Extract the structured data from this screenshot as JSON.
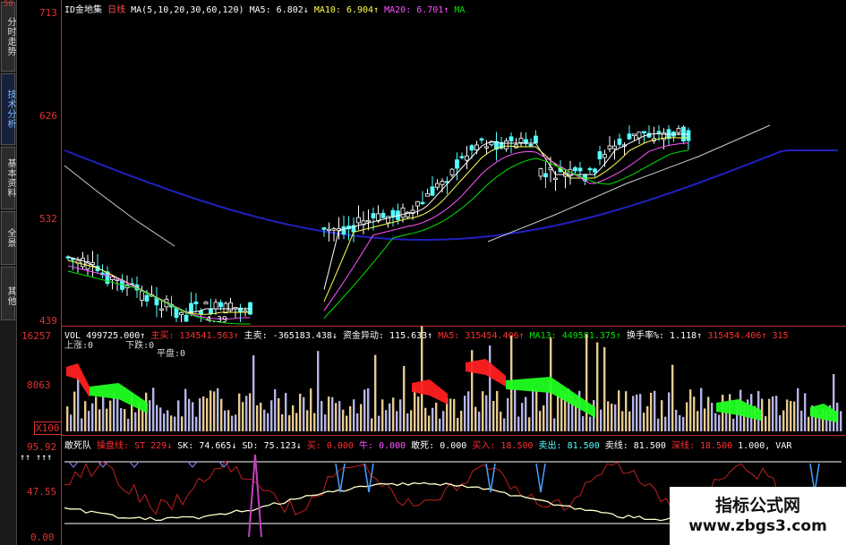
{
  "sidebar": {
    "tabs": [
      {
        "label": "分时走势",
        "active": false
      },
      {
        "label": "技术分析",
        "active": true
      },
      {
        "label": "基本资料",
        "active": false
      },
      {
        "label": "全景",
        "active": false
      },
      {
        "label": "其他",
        "active": false
      }
    ]
  },
  "main_panel": {
    "stock_name": "ID金地集",
    "period": "日线",
    "ma_params": "MA(5,10,20,30,60,120)",
    "ma5": "MA5: 6.802↓",
    "ma10": "MA10: 6.904↑",
    "ma20": "MA20: 6.701↑",
    "ma30": "MA",
    "y_labels": [
      "713",
      "626",
      "532",
      "439"
    ],
    "corner_label": "50",
    "low_marker": "4.39"
  },
  "volume_panel": {
    "vol": "VOL 499725.000↑",
    "zhumai": "主买: 134541.563↑",
    "zhumai2": "主卖: -365183.438↓",
    "zijin": "资金异动: 115.633↑",
    "ma5": "MA5: 315454.406↑",
    "ma13": "MA13: 449581.375↑",
    "huanshou": "换手率%: 1.118↑",
    "extra": "315454.406↑ 315",
    "shangzhang": "上涨:0",
    "xiadie": "下跌:0",
    "pingpan": "平盘:0",
    "y_labels": [
      "16257",
      "8063",
      "X100"
    ]
  },
  "indicator_panel": {
    "name": "敢死队",
    "caopan": "操盘线: ST 229↓",
    "sk": "SK: 74.665↓",
    "sd": "SD: 75.123↓",
    "mai": "买: 0.000",
    "niu": "牛: 0.000",
    "gansi": "敢死: 0.000",
    "mairu": "买入: 18.500",
    "maichu": "卖出: 81.500",
    "maixian": "卖线: 81.500",
    "shenxian": "深线: 18.500",
    "tail": "1.000, VAR",
    "arrows": "↑↑ ↑↑↑",
    "y_labels": [
      "95.92",
      "47.55",
      "0.00"
    ]
  },
  "watermark": {
    "title": "指标公式网",
    "url": "www.zbgs3.com"
  },
  "colors": {
    "up": "#ff3030",
    "down": "#54ffff",
    "ma_white": "#ffffff",
    "ma_yellow": "#ffff54",
    "ma_purple": "#ff54ff",
    "ma_green": "#00e600",
    "ma_blue": "#2020c0",
    "border": "#b03030"
  }
}
